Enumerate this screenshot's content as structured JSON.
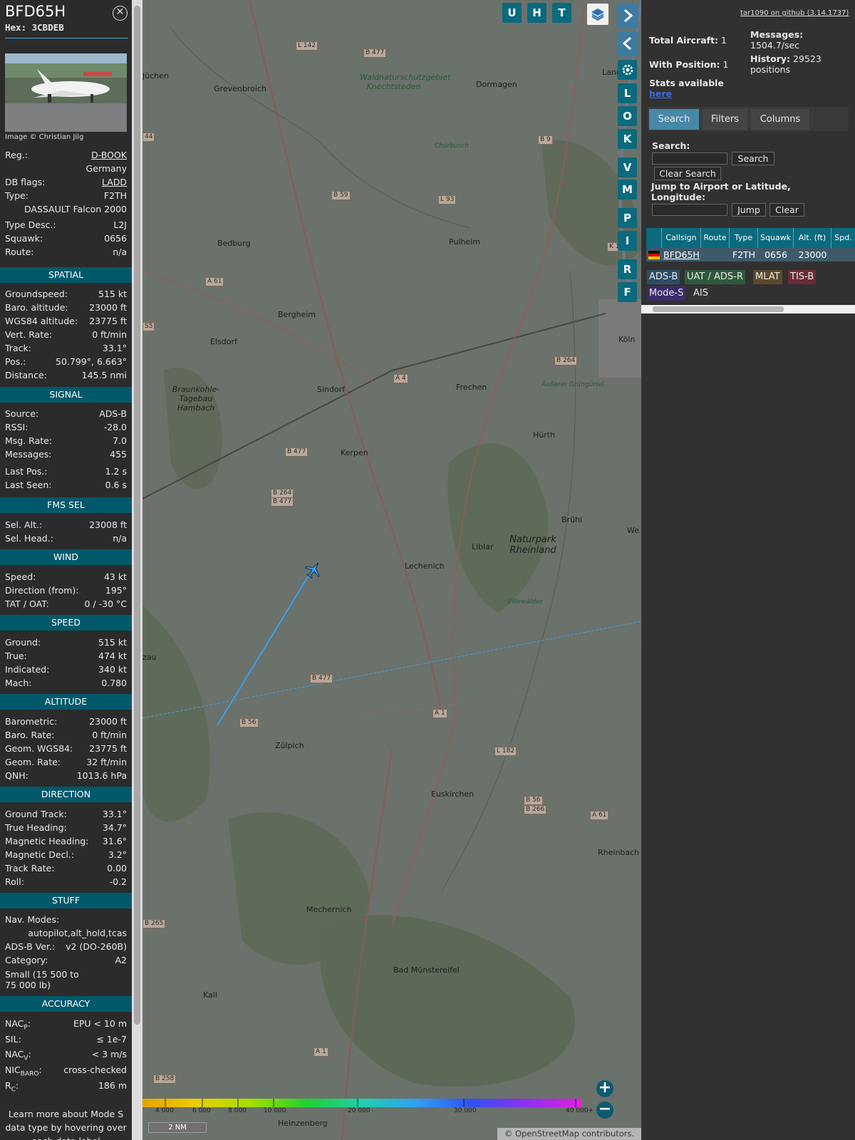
{
  "info": {
    "callsign": "BFD65H",
    "hex": "Hex: 3CBDEB",
    "close_icon": "close-icon",
    "image_credit": "Image © Christian Jilg",
    "reg_label": "Reg.:",
    "reg_value": "D-BOOK",
    "country": "Germany",
    "dbflags_label": "DB flags:",
    "dbflags_value": "LADD",
    "type_label": "Type:",
    "type_value": "F2TH",
    "type_full": "DASSAULT Falcon 2000",
    "typedesc_label": "Type Desc.:",
    "typedesc_value": "L2J",
    "squawk_label": "Squawk:",
    "squawk_value": "0656",
    "route_label": "Route:",
    "route_value": "n/a",
    "spatial": {
      "title": "SPATIAL",
      "rows": [
        [
          "Groundspeed:",
          "515 kt"
        ],
        [
          "Baro. altitude:",
          "23000 ft"
        ],
        [
          "WGS84 altitude:",
          "23775 ft"
        ],
        [
          "Vert. Rate:",
          "0 ft/min"
        ],
        [
          "Track:",
          "33.1°"
        ],
        [
          "Pos.:",
          "50.799°, 6.663°"
        ],
        [
          "Distance:",
          "145.5 nmi"
        ]
      ]
    },
    "signal": {
      "title": "SIGNAL",
      "rows": [
        [
          "Source:",
          "ADS-B"
        ],
        [
          "RSSI:",
          "-28.0"
        ],
        [
          "Msg. Rate:",
          "7.0"
        ],
        [
          "Messages:",
          "455"
        ]
      ],
      "rows2": [
        [
          "Last Pos.:",
          "1.2 s"
        ],
        [
          "Last Seen:",
          "0.6 s"
        ]
      ]
    },
    "fms": {
      "title": "FMS SEL",
      "rows": [
        [
          "Sel. Alt.:",
          "23008 ft"
        ],
        [
          "Sel. Head.:",
          "n/a"
        ]
      ]
    },
    "wind": {
      "title": "WIND",
      "rows": [
        [
          "Speed:",
          "43 kt"
        ],
        [
          "Direction (from):",
          "195°"
        ],
        [
          "TAT / OAT:",
          "0 / -30 °C"
        ]
      ]
    },
    "speed": {
      "title": "SPEED",
      "rows": [
        [
          "Ground:",
          "515 kt"
        ],
        [
          "True:",
          "474 kt"
        ],
        [
          "Indicated:",
          "340 kt"
        ],
        [
          "Mach:",
          "0.780"
        ]
      ]
    },
    "altitude": {
      "title": "ALTITUDE",
      "rows": [
        [
          "Barometric:",
          "23000 ft"
        ],
        [
          "Baro. Rate:",
          "0 ft/min"
        ],
        [
          "Geom. WGS84:",
          "23775 ft"
        ],
        [
          "Geom. Rate:",
          "32 ft/min"
        ],
        [
          "QNH:",
          "1013.6 hPa"
        ]
      ]
    },
    "direction": {
      "title": "DIRECTION",
      "rows": [
        [
          "Ground Track:",
          "33.1°"
        ],
        [
          "True Heading:",
          "34.7°"
        ],
        [
          "Magnetic Heading:",
          "31.6°"
        ],
        [
          "Magnetic Decl.:",
          "3.2°"
        ],
        [
          "Track Rate:",
          "0.00"
        ],
        [
          "Roll:",
          "-0.2"
        ]
      ]
    },
    "stuff": {
      "title": "STUFF",
      "nav_label": "Nav. Modes:",
      "nav_value": "autopilot,alt_hold,tcas",
      "adsb_label": "ADS-B Ver.:",
      "adsb_value": "v2 (DO-260B)",
      "cat_label": "Category:",
      "cat_value": "A2",
      "cat_desc": "Small (15 500 to 75 000 lb)"
    },
    "accuracy": {
      "title": "ACCURACY",
      "nacp_k": "NAC",
      "nacp_sub": "P",
      "nacp_v": "EPU < 10 m",
      "sil_k": "SIL:",
      "sil_v": "≤ 1e-7",
      "nacv_k": "NAC",
      "nacv_sub": "V",
      "nacv_v": "< 3 m/s",
      "nic_k": "NIC",
      "nic_sub": "BARO",
      "nic_v": "cross-checked",
      "rc_k": "R",
      "rc_sub": "C",
      "rc_v": "186 m"
    },
    "learn_more": "Learn more about Mode S data type by hovering over each data label"
  },
  "map": {
    "buttons_top": [
      "U",
      "H",
      "T"
    ],
    "side_buttons": [
      "L",
      "O",
      "K",
      "V",
      "M",
      "P",
      "I",
      "R",
      "F"
    ],
    "layers_icon": "layers-icon",
    "gear_icon": "gear-icon",
    "expand_icon": "chevron-right-icon",
    "collapse_icon": "chevron-left-icon",
    "toggle_icon": "expand-horizontal-icon",
    "zoom_in": "+",
    "zoom_out": "−",
    "scale": "2 NM",
    "attribution": "© OpenStreetMap contributors.",
    "alt_scale_labels": [
      "4 000",
      "6 000",
      "8 000",
      "10 000",
      "20 000",
      "30 000",
      "40 000+"
    ],
    "alt_scale_colors": [
      "#e8a200",
      "#e8d000",
      "#a0e000",
      "#20d030",
      "#20d0b0",
      "#30a0f0",
      "#3050f0",
      "#9030f0",
      "#e020e0"
    ],
    "towns": [
      "Jüchen",
      "Grevenbroich",
      "Dormagen",
      "Langen",
      "Waldnaturschutzgebiet Knechtsteden",
      "Chorbusch",
      "Bedburg",
      "Pulheim",
      "Bergheim",
      "Köln",
      "Elsdorf",
      "Sindorf",
      "Frechen",
      "Äußerer Grüngürtel",
      "Braunkohle-Tagebau Hambach",
      "Kerpen",
      "Hürth",
      "Brühl",
      "Naturpark Rheinland",
      "Liblar",
      "Lechenich",
      "Villewälder",
      "Zülpich",
      "Euskirchen",
      "Rheinbach",
      "Mechernich",
      "Bad Münstereifel",
      "Kall",
      "Heinzenberg",
      "We",
      "zau"
    ],
    "roads": [
      "L 142",
      "B 477",
      "B 9",
      "B 59",
      "L 93",
      "A 61",
      "44",
      "S5",
      "A 4",
      "B 264",
      "B 477",
      "B 264",
      "B 477",
      "B 477",
      "B 56",
      "A 1",
      "L 182",
      "B 56",
      "B 266",
      "A 61",
      "B 265",
      "A 1",
      "B 258",
      "K 1"
    ],
    "aircraft_icon": "aircraft-icon",
    "track_color": "#3aa0e8"
  },
  "stats": {
    "github": "tar1090 on github (3.14.1737)",
    "total_label": "Total Aircraft:",
    "total_value": "1",
    "pos_label": "With Position:",
    "pos_value": "1",
    "msg_label": "Messages:",
    "msg_value": "1504.7/sec",
    "hist_label": "History:",
    "hist_value": "29523 positions",
    "stats_avail": "Stats available",
    "here": "here"
  },
  "tabs": [
    "Search",
    "Filters",
    "Columns"
  ],
  "search": {
    "label": "Search:",
    "button": "Search",
    "clear": "Clear Search",
    "jump_label": "Jump to Airport or Latitude, Longitude:",
    "jump": "Jump",
    "jump_clear": "Clear"
  },
  "table": {
    "headers": [
      "Callsign",
      "Route",
      "Type",
      "Squawk",
      "Alt. (ft)",
      "Spd."
    ],
    "row": {
      "callsign": "BFD65H",
      "route": "",
      "type": "F2TH",
      "squawk": "0656",
      "alt": "23000",
      "flag_icon": "germany-flag-icon"
    }
  },
  "legend": [
    {
      "label": "ADS-B",
      "color": "#2d4d66"
    },
    {
      "label": "UAT / ADS-R",
      "color": "#2d5a3b"
    },
    {
      "label": "MLAT",
      "color": "#5a4a2b"
    },
    {
      "label": "TIS-B",
      "color": "#6b2b36"
    },
    {
      "label": "Mode-S",
      "color": "#3c2b6b"
    },
    {
      "label": "AIS",
      "color": "#333333"
    }
  ]
}
